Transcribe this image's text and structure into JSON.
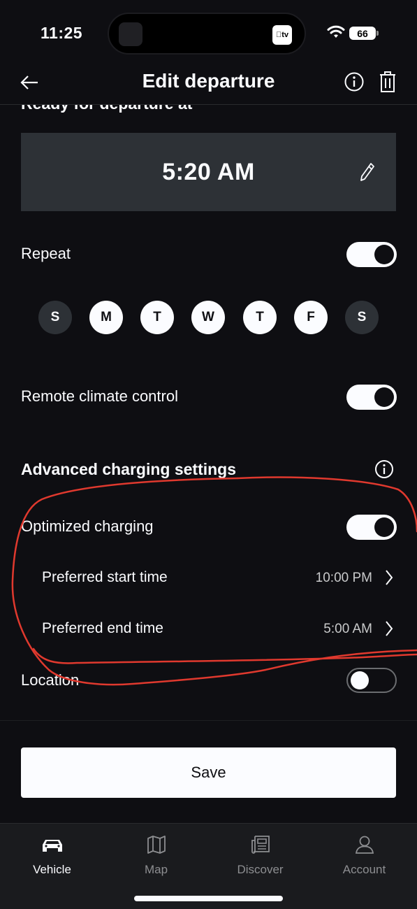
{
  "status": {
    "time": "11:25",
    "battery": "66",
    "island_app": "tv"
  },
  "nav": {
    "title": "Edit departure"
  },
  "content": {
    "cut_heading": "Ready for departure at",
    "departure_time": "5:20 AM",
    "repeat_label": "Repeat",
    "repeat_on": true,
    "days": [
      {
        "letter": "S",
        "active": false
      },
      {
        "letter": "M",
        "active": true
      },
      {
        "letter": "T",
        "active": true
      },
      {
        "letter": "W",
        "active": true
      },
      {
        "letter": "T",
        "active": true
      },
      {
        "letter": "F",
        "active": true
      },
      {
        "letter": "S",
        "active": false
      }
    ],
    "climate_label": "Remote climate control",
    "climate_on": true,
    "advanced_title": "Advanced charging settings",
    "optimized_label": "Optimized charging",
    "optimized_on": true,
    "start_label": "Preferred start time",
    "start_value": "10:00 PM",
    "end_label": "Preferred end time",
    "end_value": "5:00 AM",
    "location_label": "Location",
    "location_on": false
  },
  "footer": {
    "save_label": "Save"
  },
  "tabs": [
    {
      "label": "Vehicle",
      "icon": "car-icon",
      "active": true
    },
    {
      "label": "Map",
      "icon": "map-icon",
      "active": false
    },
    {
      "label": "Discover",
      "icon": "news-icon",
      "active": false
    },
    {
      "label": "Account",
      "icon": "user-icon",
      "active": false
    }
  ],
  "colors": {
    "background": "#0e0e12",
    "surface": "#2d3136",
    "text": "#fbfcff",
    "annotation": "#e0392e"
  }
}
